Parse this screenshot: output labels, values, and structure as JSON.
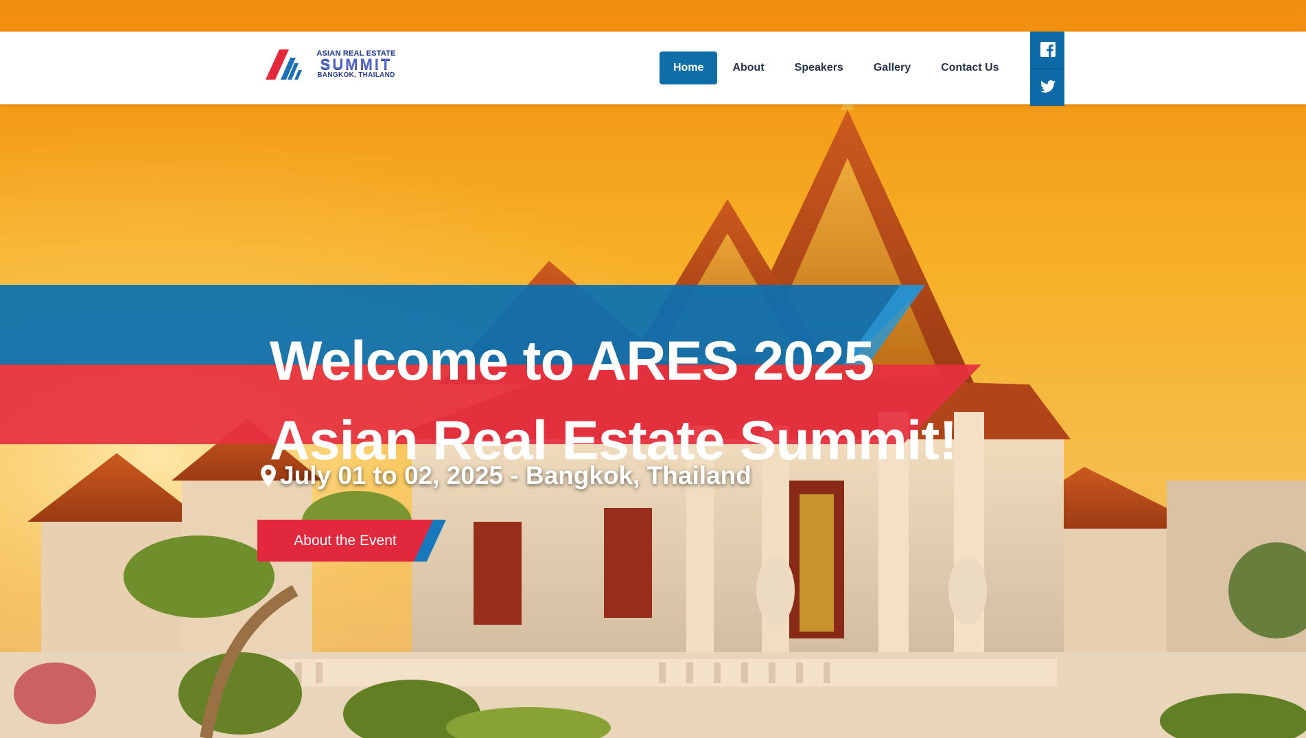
{
  "header": {
    "logo": {
      "line1": "ASIAN REAL ESTATE",
      "line2": "SUMMIT",
      "line3": "BANGKOK, THAILAND"
    },
    "nav": [
      {
        "label": "Home",
        "active": true
      },
      {
        "label": "About",
        "active": false
      },
      {
        "label": "Speakers",
        "active": false
      },
      {
        "label": "Gallery",
        "active": false
      },
      {
        "label": "Contact Us",
        "active": false
      }
    ],
    "social": [
      {
        "icon": "facebook-icon"
      },
      {
        "icon": "twitter-icon"
      }
    ]
  },
  "hero": {
    "title_line1": "Welcome to ARES 2025",
    "title_line2": "Asian Real Estate Summit!",
    "date_icon": "map-pin-icon",
    "date_text": "July 01 to 02, 2025 - Bangkok, Thailand",
    "cta_label": "About the Event"
  },
  "colors": {
    "primary_blue": "#0f6ea8",
    "accent_red": "#e2283c",
    "sky_orange": "#f39a1b"
  }
}
